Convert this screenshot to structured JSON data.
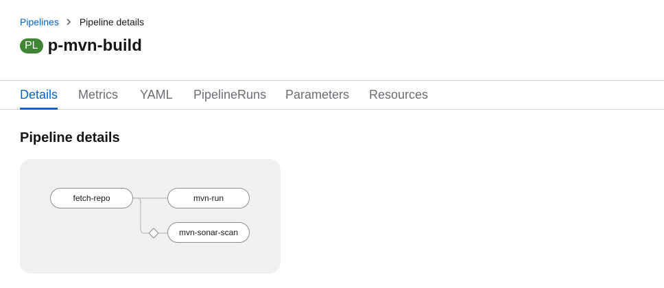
{
  "breadcrumb": {
    "parent": "Pipelines",
    "current": "Pipeline details"
  },
  "header": {
    "badge": "PL",
    "badge_color": "#3e8635",
    "title": "p-mvn-build"
  },
  "tabs": [
    {
      "label": "Details",
      "active": true
    },
    {
      "label": "Metrics"
    },
    {
      "label": "YAML"
    },
    {
      "label": "PipelineRuns"
    },
    {
      "label": "Parameters"
    },
    {
      "label": "Resources"
    }
  ],
  "section": {
    "title": "Pipeline details"
  },
  "pipeline": {
    "tasks": [
      {
        "name": "fetch-repo"
      },
      {
        "name": "mvn-run"
      },
      {
        "name": "mvn-sonar-scan"
      }
    ]
  },
  "colors": {
    "accent": "#0066cc",
    "panel_bg": "#f0f0f0"
  }
}
